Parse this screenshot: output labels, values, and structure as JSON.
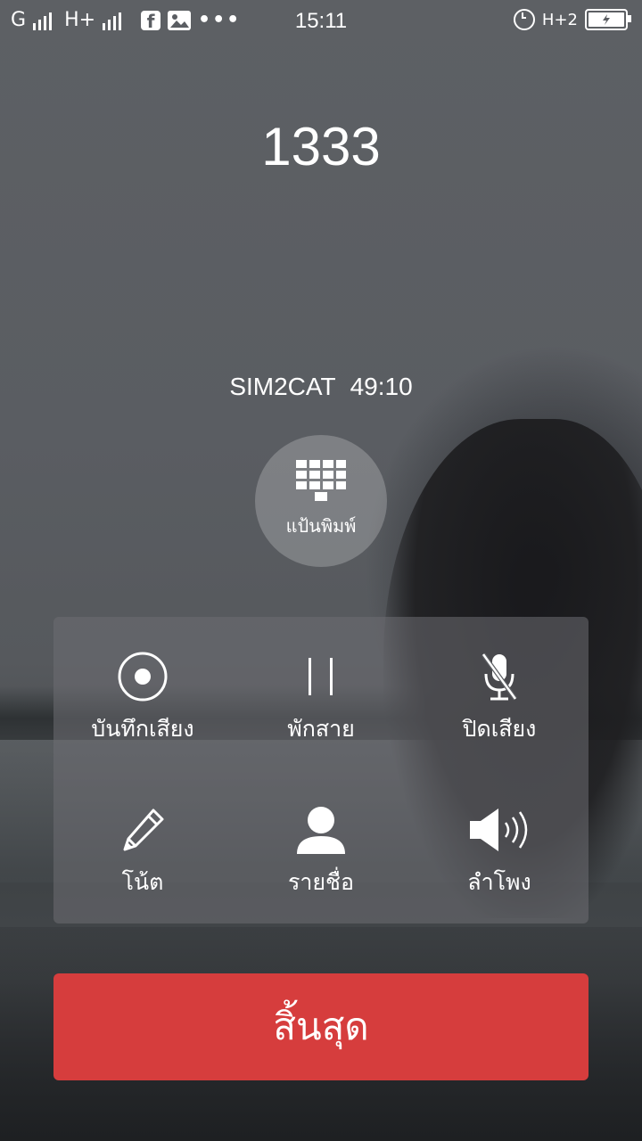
{
  "status_bar": {
    "sim1_network": "G",
    "sim2_network": "H+",
    "time": "15:11",
    "data_indicator": "H+2",
    "icons": [
      "signal-icon",
      "facebook-icon",
      "image-icon",
      "more-dots-icon",
      "alarm-icon",
      "battery-charging-icon"
    ]
  },
  "call": {
    "number": "1333",
    "sim_label": "SIM2CAT",
    "duration": "49:10"
  },
  "keypad": {
    "label": "แป้นพิมพ์"
  },
  "controls": {
    "record": {
      "label": "บันทึกเสียง"
    },
    "hold": {
      "label": "พักสาย"
    },
    "mute": {
      "label": "ปิดเสียง"
    },
    "note": {
      "label": "โน้ต"
    },
    "contacts": {
      "label": "รายชื่อ"
    },
    "speaker": {
      "label": "ลำโพง"
    }
  },
  "end_call": {
    "label": "สิ้นสุด",
    "color": "#d63d3d"
  }
}
